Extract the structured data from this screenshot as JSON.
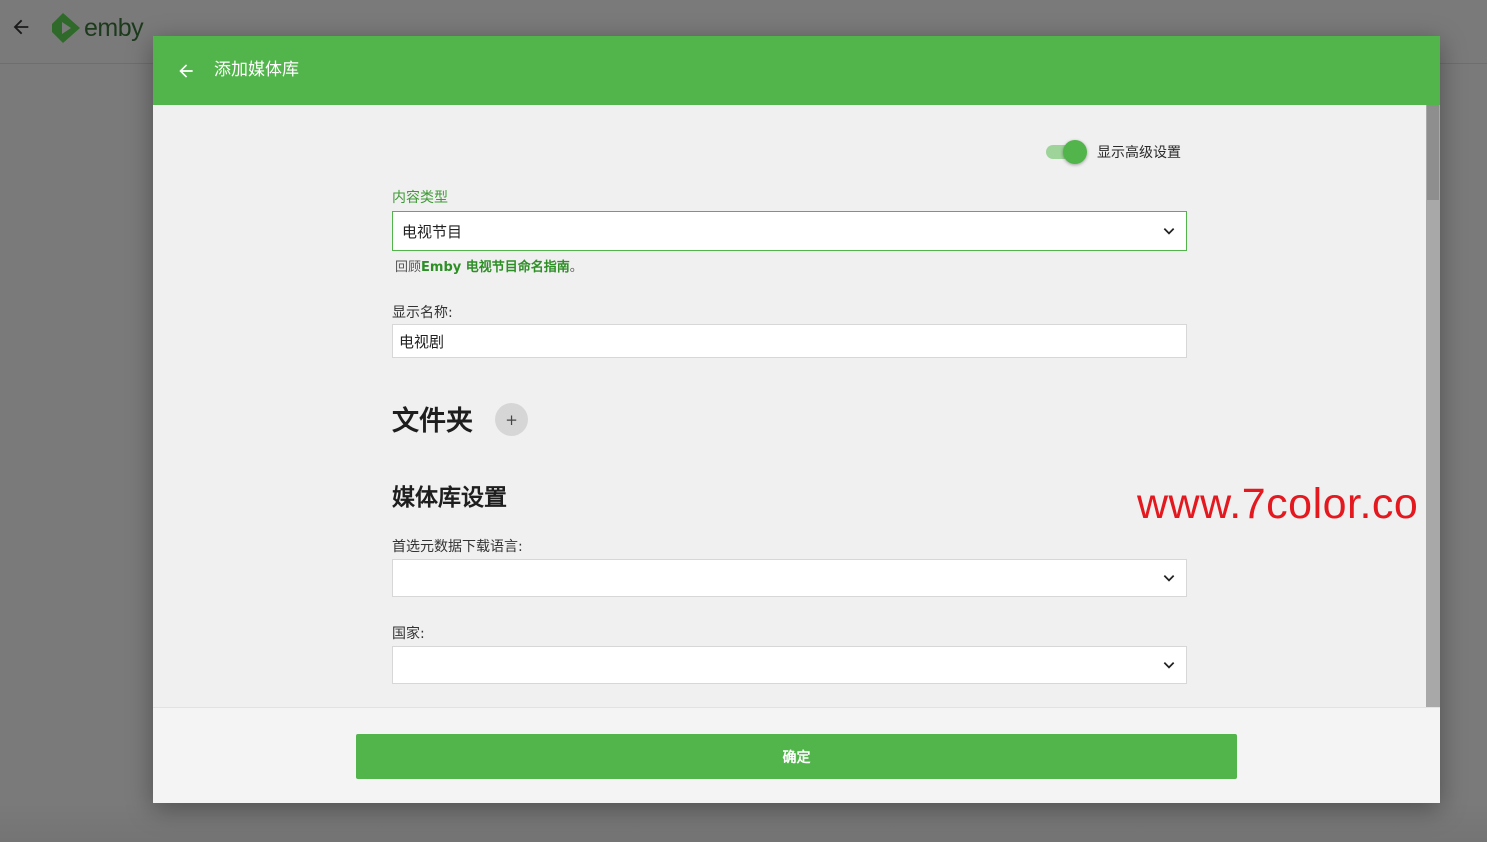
{
  "app": {
    "logo_text": "emby"
  },
  "dialog": {
    "title": "添加媒体库",
    "advanced_toggle": {
      "label": "显示高级设置",
      "enabled": true
    },
    "content_type": {
      "label": "内容类型",
      "value": "电视节目",
      "helper_prefix": "回顾",
      "helper_link": "Emby 电视节目命名指南",
      "helper_suffix": "。"
    },
    "display_name": {
      "label": "显示名称:",
      "value": "电视剧"
    },
    "folders": {
      "title": "文件夹",
      "add_label": "+"
    },
    "library_settings": {
      "title": "媒体库设置",
      "metadata_language": {
        "label": "首选元数据下载语言:",
        "value": ""
      },
      "country": {
        "label": "国家:",
        "value": ""
      }
    },
    "watermark": "www.7color.co",
    "confirm_label": "确定"
  },
  "colors": {
    "accent": "#52b54b",
    "link": "#2e8f27",
    "watermark": "#e3191f"
  }
}
